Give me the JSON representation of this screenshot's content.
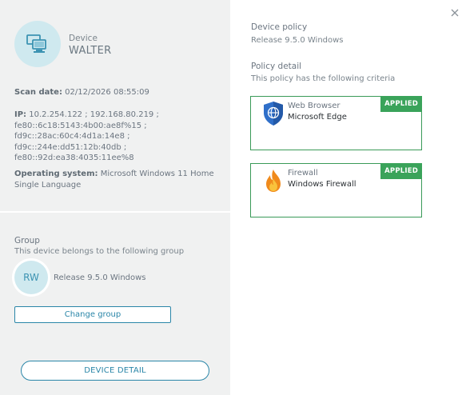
{
  "device": {
    "label": "Device",
    "name": "WALTER",
    "scan_label": "Scan date:",
    "scan_value": "02/12/2026 08:55:09",
    "ip_label": "IP:",
    "ip_value": "10.2.254.122 ; 192.168.80.219 ; fe80::6c18:5143:4b00:ae8f%15 ; fd9c::28ac:60c4:4d1a:14e8 ; fd9c::244e:dd51:12b:40db ; fe80::92d:ea38:4035:11ee%8",
    "os_label": "Operating system:",
    "os_value": "Microsoft Windows 11 Home Single Language",
    "icon": "computer-icon"
  },
  "group": {
    "title": "Group",
    "subtitle": "This device belongs to the following group",
    "initials": "RW",
    "name": "Release 9.5.0 Windows",
    "change_label": "Change group"
  },
  "device_detail_label": "DEVICE DETAIL",
  "policy": {
    "title": "Device policy",
    "name": "Release 9.5.0 Windows",
    "detail_title": "Policy detail",
    "detail_subtitle": "This policy has the following criteria",
    "criteria": [
      {
        "type": "Web Browser",
        "name": "Microsoft Edge",
        "status": "APPLIED",
        "icon": "globe-shield-icon"
      },
      {
        "type": "Firewall",
        "name": "Windows Firewall",
        "status": "APPLIED",
        "icon": "fire-icon"
      }
    ]
  },
  "colors": {
    "accent": "#2a86a8",
    "applied": "#3aa35a",
    "panel": "#f0f1f1",
    "avatar": "#cfe9ef"
  }
}
